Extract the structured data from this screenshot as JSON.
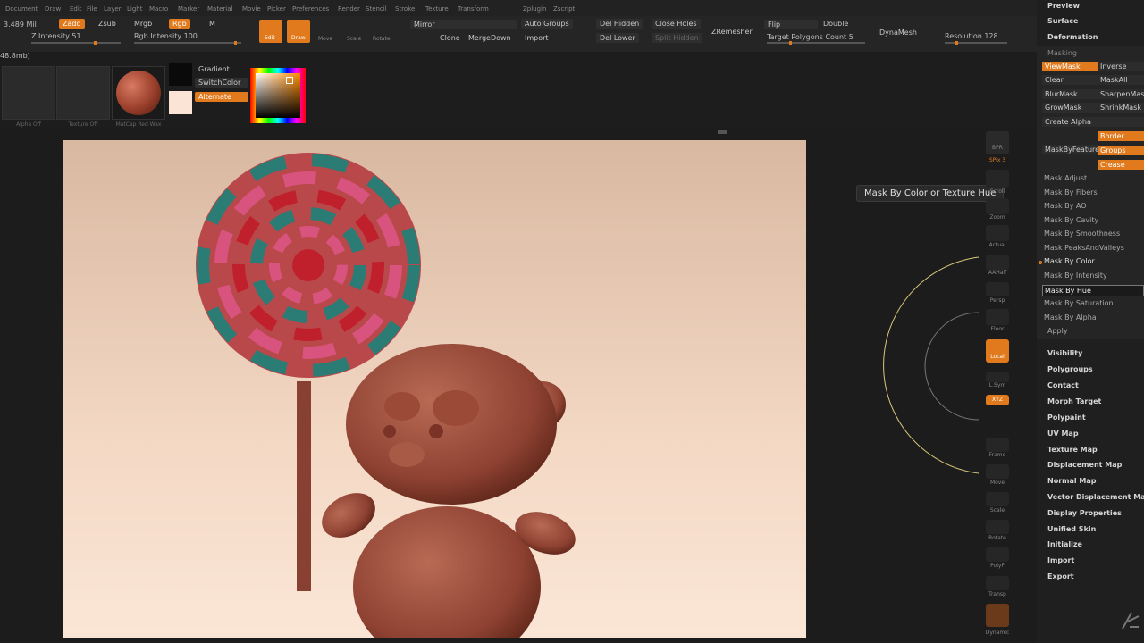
{
  "menu": [
    "Document",
    "Draw",
    "Edit",
    "File",
    "Layer",
    "Light",
    "Macro",
    "Marker",
    "Material",
    "Movie",
    "Picker",
    "Preferences",
    "Render",
    "Stencil",
    "Stroke",
    "Texture",
    "Transform",
    "Zplugin",
    "Zscript"
  ],
  "top": {
    "mem": "3.489 Mil",
    "mem2": "48.8mb)",
    "zadd": "Zadd",
    "zsub": "Zsub",
    "mrgb": "Mrgb",
    "rgb": "Rgb",
    "m": "M",
    "z_intensity": "Z Intensity 51",
    "rgb_intensity": "Rgb Intensity 100",
    "edit": "Edit",
    "draw": "Draw",
    "move": "Move",
    "scale": "Scale",
    "rotate": "Rotate",
    "mirror": "Mirror",
    "clone": "Clone",
    "mergedown": "MergeDown",
    "auto_groups": "Auto Groups",
    "import": "Import",
    "del_hidden": "Del Hidden",
    "del_lower": "Del Lower",
    "close_holes": "Close Holes",
    "split_hidden": "Split Hidden",
    "zremesher": "ZRemesher",
    "flip": "Flip",
    "double": "Double",
    "target_poly": "Target Polygons Count 5",
    "dynamesh": "DynaMesh",
    "resolution": "Resolution 128"
  },
  "sub": {
    "alpha_off": "Alpha Off",
    "texture_off": "Texture Off",
    "matcap": "MatCap Red Wax",
    "gradient": "Gradient",
    "switchcolor": "SwitchColor",
    "alternate": "Alternate"
  },
  "tooltip": "Mask By Color or Texture Hue",
  "right_tools": [
    {
      "label": "BPR"
    },
    {
      "label": "SPix 3"
    },
    {
      "label": "Scroll"
    },
    {
      "label": "Zoom"
    },
    {
      "label": "Actual"
    },
    {
      "label": "AAHalf"
    },
    {
      "label": "Persp"
    },
    {
      "label": "Floor"
    },
    {
      "label": "Local"
    },
    {
      "label": "L.Sym"
    },
    {
      "label": "XYZ"
    },
    {
      "label": "Frame"
    },
    {
      "label": "Move"
    },
    {
      "label": "Scale"
    },
    {
      "label": "Rotate"
    },
    {
      "label": "PolyF"
    },
    {
      "label": "Transp"
    },
    {
      "label": "Dynamic"
    }
  ],
  "panel": {
    "preview": "Preview",
    "surface": "Surface",
    "deformation": "Deformation",
    "masking": "Masking",
    "viewmask": "ViewMask",
    "inverse": "Inverse",
    "clear": "Clear",
    "maskall": "MaskAll",
    "blurmask": "BlurMask",
    "sharpenmask": "SharpenMask",
    "growmask": "GrowMask",
    "shrinkmask": "ShrinkMask",
    "create_alpha": "Create Alpha",
    "maskbyfeature": "MaskByFeature",
    "border": "Border",
    "groups": "Groups",
    "crease": "Crease",
    "mask_items": [
      "Mask Adjust",
      "Mask By Fibers",
      "Mask By AO",
      "Mask By Cavity",
      "Mask By Smoothness",
      "Mask PeaksAndValleys",
      "Mask By Color",
      "Mask By Intensity",
      "Mask By Hue",
      "Mask By Saturation",
      "Mask By Alpha",
      "Apply"
    ],
    "sections": [
      "Visibility",
      "Polygroups",
      "Contact",
      "Morph Target",
      "Polypaint",
      "UV Map",
      "Texture Map",
      "Displacement Map",
      "Normal Map",
      "Vector Displacement Map",
      "Display Properties",
      "Unified Skin",
      "Initialize",
      "Import",
      "Export"
    ]
  }
}
